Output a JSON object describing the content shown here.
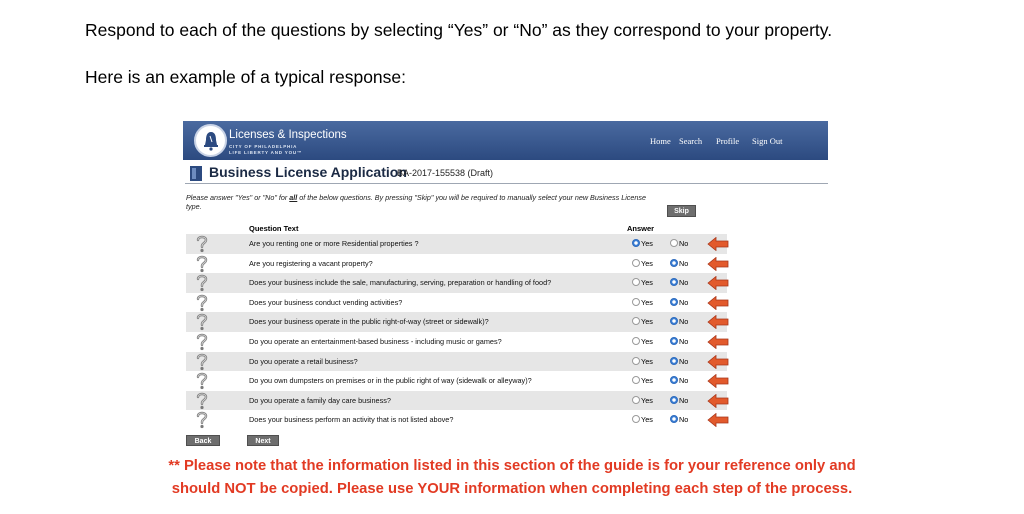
{
  "intro": {
    "line1": "Respond to each of the questions by selecting “Yes” or “No” as they correspond to your property.",
    "line2": "Here is an example of a typical response:"
  },
  "app": {
    "brand": "Licenses & Inspections",
    "brand_sub1": "CITY OF PHILADELPHIA",
    "brand_sub2": "LIFE LIBERTY AND YOU™",
    "nav": {
      "home": "Home",
      "search": "Search",
      "profile": "Profile",
      "signout": "Sign Out"
    },
    "title": "Business License Application",
    "title_id": "BA-2017-155538 (Draft)",
    "instructions": {
      "part1": "Please answer \"Yes\" or \"No\" for ",
      "emph": "all",
      "part2": " of the below questions. By pressing \"Skip\" you will be required to manually select your new Business License type."
    },
    "skip_label": "Skip",
    "col_question": "Question Text",
    "col_answer": "Answer",
    "yes_label": "Yes",
    "no_label": "No",
    "back_label": "Back",
    "next_label": "Next",
    "questions": [
      {
        "text": "Are you renting one or more Residential properties ?",
        "answer": "Yes"
      },
      {
        "text": "Are you registering a vacant property?",
        "answer": "No"
      },
      {
        "text": "Does your business include the sale, manufacturing, serving, preparation or handling of food?",
        "answer": "No"
      },
      {
        "text": "Does your business conduct vending activities?",
        "answer": "No"
      },
      {
        "text": "Does your business operate in the public right-of-way (street or sidewalk)?",
        "answer": "No"
      },
      {
        "text": "Do you operate an entertainment-based business - including music or games?",
        "answer": "No"
      },
      {
        "text": "Do you operate a retail business?",
        "answer": "No"
      },
      {
        "text": "Do you own dumpsters on premises or in the public right of way (sidewalk or alleyway)?",
        "answer": "No"
      },
      {
        "text": "Do you operate a family day care business?",
        "answer": "No"
      },
      {
        "text": "Does your business perform an activity that is not listed above?",
        "answer": "No"
      }
    ],
    "colors": {
      "header": "#2c4a80",
      "radio_selected": "#3b7fd6",
      "arrow": "#e25a2c"
    },
    "icons": {
      "question": "question-mark-icon",
      "arrow": "left-arrow-icon",
      "seal": "liberty-bell-icon"
    }
  },
  "note": {
    "line1": "** Please note that the information listed in this section of the guide is for your reference only and",
    "line2": "should NOT be copied. Please use YOUR information when completing each step of the process.",
    "color": "#e23a23"
  }
}
